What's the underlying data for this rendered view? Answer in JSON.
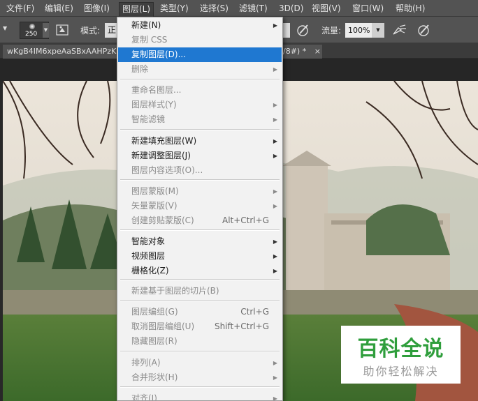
{
  "menubar": {
    "items": [
      "文件(F)",
      "编辑(E)",
      "图像(I)",
      "图层(L)",
      "类型(Y)",
      "选择(S)",
      "滤镜(T)",
      "3D(D)",
      "视图(V)",
      "窗口(W)",
      "帮助(H)"
    ],
    "active_index": 3
  },
  "options_bar": {
    "brush_size": "250",
    "mode_label": "模式:",
    "mode_value_partial": "正",
    "flow_label": "流量:",
    "flow_value": "100%"
  },
  "document_tab": {
    "title_left": "wKgB4IM6xpeAaSBxAAHPzK",
    "title_right": "/8#) *",
    "close_glyph": "×"
  },
  "layer_menu": {
    "items": [
      {
        "label": "新建(N)",
        "shortcut": "",
        "submenu": true,
        "disabled": false,
        "highlighted": false
      },
      {
        "label": "复制 CSS",
        "shortcut": "",
        "submenu": false,
        "disabled": true,
        "highlighted": false
      },
      {
        "label": "复制图层(D)...",
        "shortcut": "",
        "submenu": false,
        "disabled": false,
        "highlighted": true
      },
      {
        "label": "删除",
        "shortcut": "",
        "submenu": true,
        "disabled": true,
        "highlighted": false
      },
      {
        "label": "重命名图层...",
        "shortcut": "",
        "submenu": false,
        "disabled": true,
        "highlighted": false
      },
      {
        "label": "图层样式(Y)",
        "shortcut": "",
        "submenu": true,
        "disabled": true,
        "highlighted": false
      },
      {
        "label": "智能滤镜",
        "shortcut": "",
        "submenu": true,
        "disabled": true,
        "highlighted": false
      },
      {
        "label": "新建填充图层(W)",
        "shortcut": "",
        "submenu": true,
        "disabled": false,
        "highlighted": false
      },
      {
        "label": "新建调整图层(J)",
        "shortcut": "",
        "submenu": true,
        "disabled": false,
        "highlighted": false
      },
      {
        "label": "图层内容选项(O)...",
        "shortcut": "",
        "submenu": false,
        "disabled": true,
        "highlighted": false
      },
      {
        "label": "图层蒙版(M)",
        "shortcut": "",
        "submenu": true,
        "disabled": true,
        "highlighted": false
      },
      {
        "label": "矢量蒙版(V)",
        "shortcut": "",
        "submenu": true,
        "disabled": true,
        "highlighted": false
      },
      {
        "label": "创建剪贴蒙版(C)",
        "shortcut": "Alt+Ctrl+G",
        "submenu": false,
        "disabled": true,
        "highlighted": false
      },
      {
        "label": "智能对象",
        "shortcut": "",
        "submenu": true,
        "disabled": false,
        "highlighted": false
      },
      {
        "label": "视频图层",
        "shortcut": "",
        "submenu": true,
        "disabled": false,
        "highlighted": false
      },
      {
        "label": "栅格化(Z)",
        "shortcut": "",
        "submenu": true,
        "disabled": false,
        "highlighted": false
      },
      {
        "label": "新建基于图层的切片(B)",
        "shortcut": "",
        "submenu": false,
        "disabled": true,
        "highlighted": false
      },
      {
        "label": "图层编组(G)",
        "shortcut": "Ctrl+G",
        "submenu": false,
        "disabled": true,
        "highlighted": false
      },
      {
        "label": "取消图层编组(U)",
        "shortcut": "Shift+Ctrl+G",
        "submenu": false,
        "disabled": true,
        "highlighted": false
      },
      {
        "label": "隐藏图层(R)",
        "shortcut": "",
        "submenu": false,
        "disabled": true,
        "highlighted": false
      },
      {
        "label": "排列(A)",
        "shortcut": "",
        "submenu": true,
        "disabled": true,
        "highlighted": false
      },
      {
        "label": "合并形状(H)",
        "shortcut": "",
        "submenu": true,
        "disabled": true,
        "highlighted": false
      },
      {
        "label": "对齐(I)",
        "shortcut": "",
        "submenu": true,
        "disabled": true,
        "highlighted": false
      }
    ]
  },
  "watermark": {
    "line1": "百科全说",
    "line2": "助你轻松解决"
  },
  "colors": {
    "highlight": "#1f78d1",
    "watermark_green": "#2f9e3c"
  }
}
